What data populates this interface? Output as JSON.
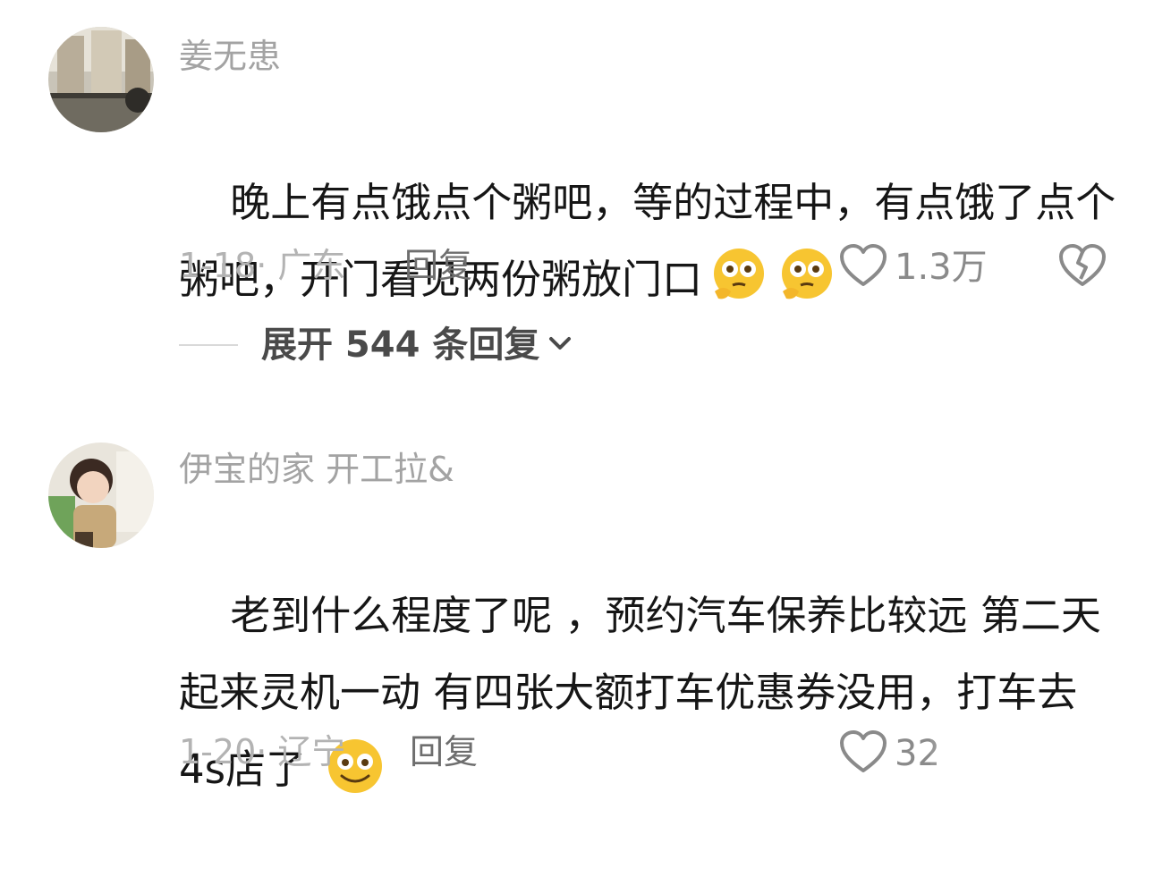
{
  "comments": [
    {
      "username": "姜无患",
      "text": "晚上有点饿点个粥吧，等的过程中，有点饿了点个粥吧，开门看见两份粥放门口",
      "emojis": [
        "thinking-face-emoji",
        "thinking-face-emoji"
      ],
      "date_location": "1-18· 广东",
      "reply_label": "回复",
      "likes": "1.3万",
      "expand_label": "展开 544 条回复"
    },
    {
      "username": "伊宝的家 开工拉&",
      "text": "老到什么程度了呢 ，预约汽车保养比较远 第二天起来灵机一动 有四张大额打车优惠券没用，打车去4s店了",
      "emojis": [
        "smiling-face-emoji"
      ],
      "date_location": "1-20· 辽宁",
      "reply_label": "回复",
      "likes": "32"
    }
  ],
  "colors": {
    "username": "#a3a3a3",
    "text": "#161616",
    "meta": "#b3b3b3",
    "emoji_yellow": "#f7c531"
  }
}
